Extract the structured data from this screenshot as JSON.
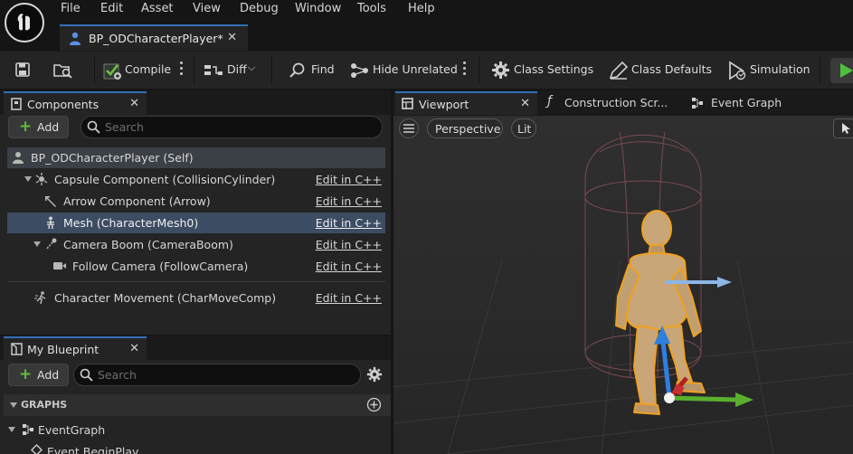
{
  "menu": {
    "items": [
      "File",
      "Edit",
      "Asset",
      "View",
      "Debug",
      "Window",
      "Tools",
      "Help"
    ]
  },
  "document_tab": {
    "title": "BP_ODCharacterPlayer*"
  },
  "toolbar": {
    "compile": "Compile",
    "diff": "Diff",
    "find": "Find",
    "hide_unrelated": "Hide Unrelated",
    "class_settings": "Class Settings",
    "class_defaults": "Class Defaults",
    "simulation": "Simulation"
  },
  "components_panel": {
    "title": "Components",
    "add_label": "Add",
    "search_placeholder": "Search",
    "self_label": "BP_ODCharacterPlayer (Self)",
    "rows": [
      {
        "label": "Capsule Component (CollisionCylinder)",
        "edit": "Edit in C++"
      },
      {
        "label": "Arrow Component (Arrow)",
        "edit": "Edit in C++"
      },
      {
        "label": "Mesh (CharacterMesh0)",
        "edit": "Edit in C++"
      },
      {
        "label": "Camera Boom (CameraBoom)",
        "edit": "Edit in C++"
      },
      {
        "label": "Follow Camera (FollowCamera)",
        "edit": "Edit in C++"
      },
      {
        "label": "Character Movement (CharMoveComp)",
        "edit": "Edit in C++"
      }
    ]
  },
  "my_blueprint": {
    "title": "My Blueprint",
    "add_label": "Add",
    "search_placeholder": "Search",
    "graphs_header": "GRAPHS",
    "event_graph": "EventGraph",
    "event_begin_play": "Event BeginPlay"
  },
  "editor_tabs": {
    "viewport": "Viewport",
    "construction": "Construction Scr...",
    "event_graph": "Event Graph"
  },
  "viewport": {
    "perspective": "Perspective",
    "lit": "Lit"
  },
  "colors": {
    "accent": "#2f6fb8",
    "selection": "#3b4c63",
    "add_plus": "#5fbf3a",
    "mannequin": "#c9a678",
    "outline": "#f0a020",
    "gizmo_x": "#5ab02e",
    "gizmo_z": "#2d7fe0"
  }
}
